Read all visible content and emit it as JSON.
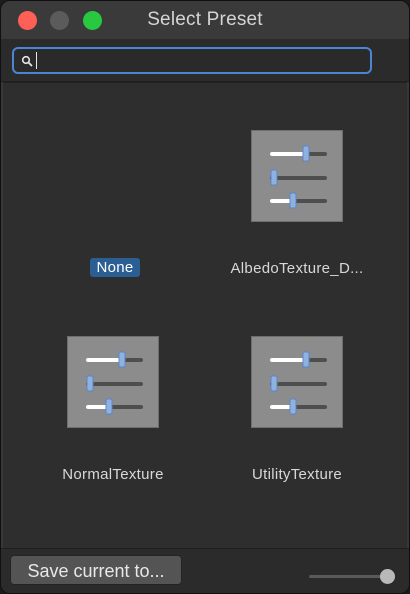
{
  "window": {
    "title": "Select Preset"
  },
  "search": {
    "value": "",
    "placeholder": ""
  },
  "presets": [
    {
      "label": "None",
      "selected": true,
      "has_icon": false
    },
    {
      "label": "AlbedoTexture_D...",
      "selected": false,
      "has_icon": true,
      "icon": "slider-settings-icon"
    },
    {
      "label": "NormalTexture",
      "selected": false,
      "has_icon": true,
      "icon": "slider-settings-icon"
    },
    {
      "label": "UtilityTexture",
      "selected": false,
      "has_icon": true,
      "icon": "slider-settings-icon"
    }
  ],
  "footer": {
    "save_label": "Save current to...",
    "zoom_level": 1.0
  },
  "colors": {
    "accent": "#4a85d6",
    "selection": "#2b5f93",
    "traffic_red": "#fe5f57",
    "traffic_green": "#28c840"
  }
}
